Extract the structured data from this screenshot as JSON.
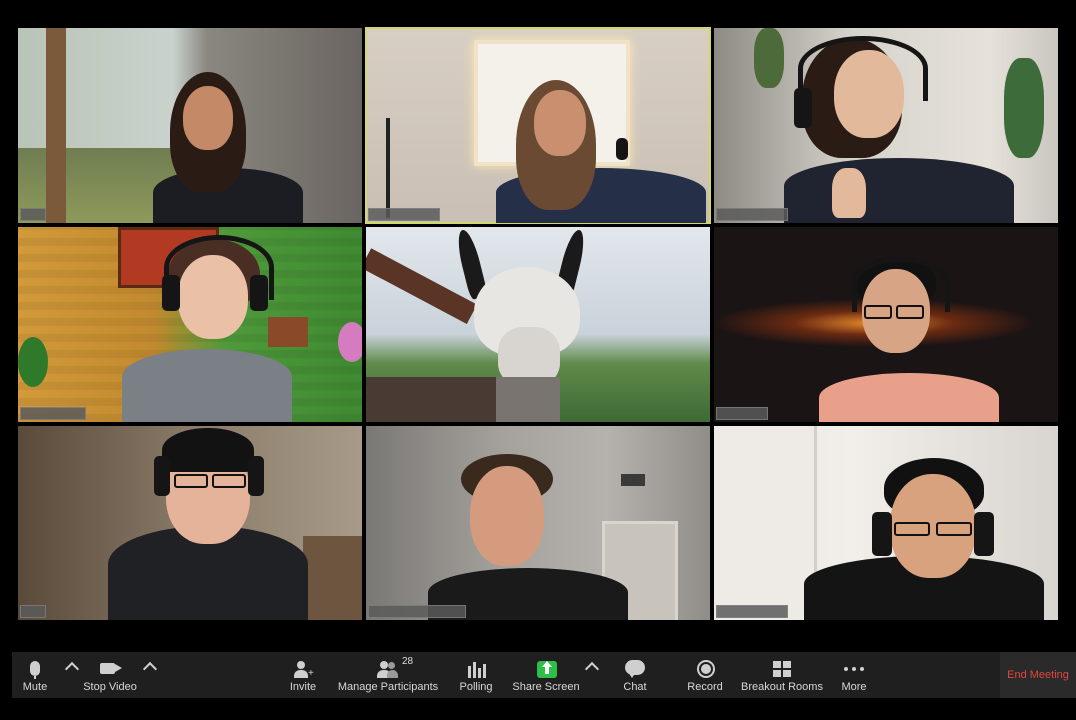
{
  "toolbar": {
    "mute": "Mute",
    "stop_video": "Stop Video",
    "invite": "Invite",
    "manage_participants": "Manage Participants",
    "participant_count": "28",
    "polling": "Polling",
    "share_screen": "Share Screen",
    "chat": "Chat",
    "record": "Record",
    "breakout_rooms": "Breakout Rooms",
    "more": "More",
    "end_meeting": "End Meeting"
  },
  "colors": {
    "toolbar_bg": "#1f1f1f",
    "active_speaker_border": "#cfd86a",
    "share_green": "#2fbe4a",
    "end_red": "#e0463c"
  },
  "icons": {
    "mute": "microphone-icon",
    "stop_video": "video-camera-icon",
    "invite": "add-person-icon",
    "manage_participants": "people-icon",
    "polling": "bar-chart-icon",
    "share_screen": "share-arrow-icon",
    "chat": "speech-bubble-icon",
    "record": "record-icon",
    "breakout_rooms": "grid-icon",
    "more": "ellipsis-icon"
  },
  "gallery": {
    "active_tile": 1
  }
}
